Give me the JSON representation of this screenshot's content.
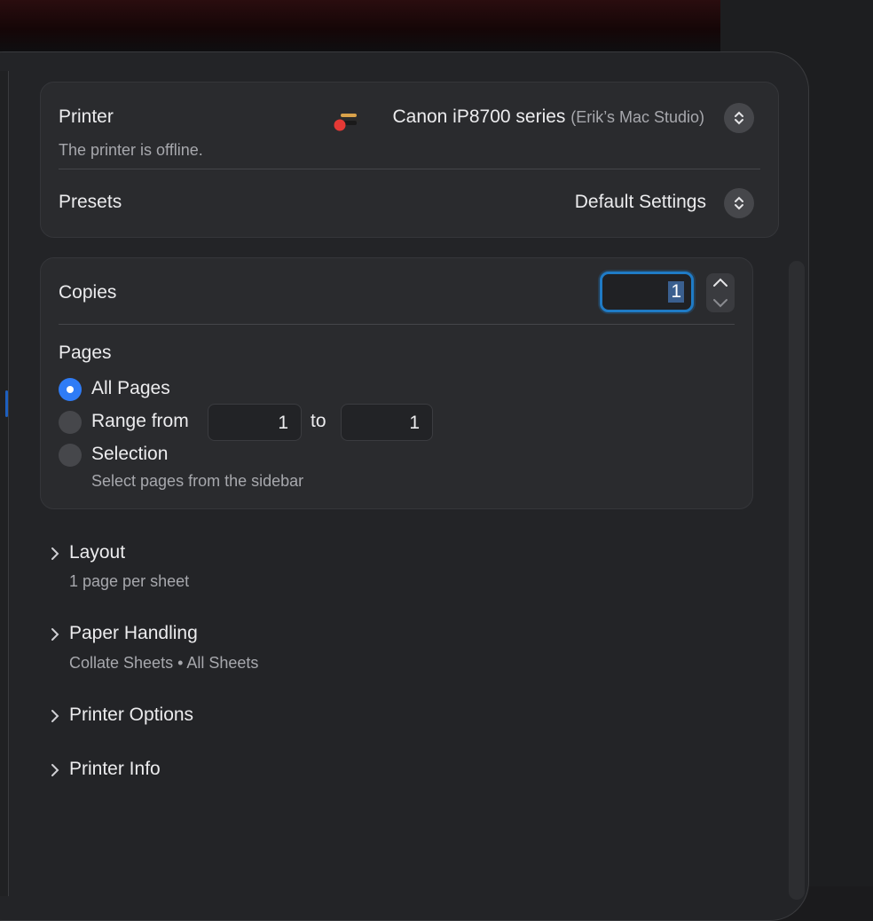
{
  "printer_card": {
    "printer_label": "Printer",
    "printer_name": "Canon iP8700 series",
    "printer_host": "(Erik’s Mac Studio)",
    "printer_status": "The printer is offline.",
    "presets_label": "Presets",
    "presets_value": "Default Settings"
  },
  "copies_card": {
    "copies_label": "Copies",
    "copies_value": "1",
    "pages_label": "Pages",
    "options": [
      {
        "label": "All Pages",
        "selected": true
      },
      {
        "label": "Range from",
        "selected": false
      },
      {
        "label": "Selection",
        "selected": false
      }
    ],
    "range_from": "1",
    "range_to_label": "to",
    "range_to": "1",
    "selection_hint": "Select pages from the sidebar"
  },
  "sections": [
    {
      "title": "Layout",
      "summary": "1 page per sheet"
    },
    {
      "title": "Paper Handling",
      "summary": "Collate Sheets • All Sheets"
    },
    {
      "title": "Printer Options",
      "summary": ""
    },
    {
      "title": "Printer Info",
      "summary": ""
    }
  ],
  "colors": {
    "accent": "#2f7cf6",
    "focus_ring": "#1f7bc6",
    "offline_dot": "#e53935"
  }
}
